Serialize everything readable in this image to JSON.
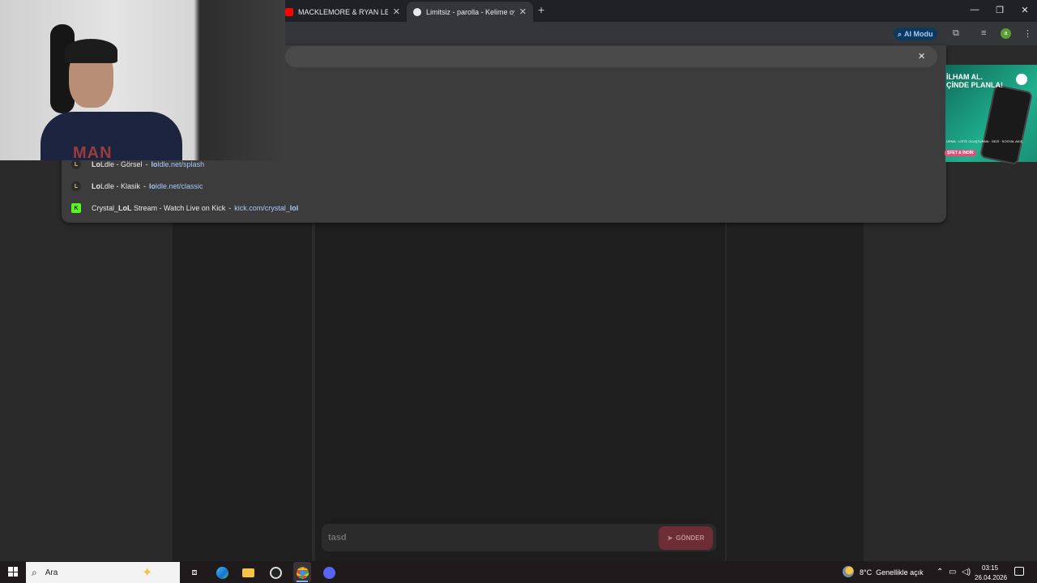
{
  "browser": {
    "tabs": [
      {
        "title": "MACKLEMORE & RYAN LEWIS",
        "favicon_color": "#ff0000",
        "active": false
      },
      {
        "title": "Limitsiz - parolla - Kelime oyunu",
        "favicon_color": "#e8eaed",
        "active": true
      }
    ],
    "new_tab_icon": "plus-icon",
    "window_controls": {
      "minimize": "—",
      "restore": "❐",
      "close": "✕"
    },
    "ai_mode_label": "AI Modu",
    "profile_initial": "a"
  },
  "omnibox": {
    "clear_icon": "✕",
    "suggestions": [
      {
        "bold": "Lo",
        "rest": "Ldle - Görsel",
        "sep": "-",
        "url_bold": "lo",
        "url_rest": "ldle.net/splash",
        "icon": "L"
      },
      {
        "bold": "Lo",
        "rest": "Ldle - Klasik",
        "sep": "-",
        "url_bold": "lo",
        "url_rest": "ldle.net/classic",
        "icon": "L"
      },
      {
        "prefix": "Crystal_",
        "bold": "LoL",
        "rest": " Stream - Watch Live on Kick",
        "sep": "-",
        "url_rest": "kick.com/crystal_",
        "url_bold": "lol",
        "icon": "K"
      }
    ]
  },
  "webcam": {
    "shirt_text": "MAN"
  },
  "ad": {
    "line1": "İLHAM AL.",
    "line2": "ÇİNDE PLANLA!",
    "small_text": "URMA · LİSTE OLUŞTURMA · GEZİ · SOSYAL AKIŞ",
    "button": "ŞFET & İNDİR"
  },
  "chat": {
    "input_value": "tasd",
    "send_label": "GÖNDER",
    "send_icon": "➤"
  },
  "taskbar": {
    "search_placeholder": "Ara",
    "weather": "8°C  Genellikle açık",
    "time": "03:15",
    "date": "26.04.2026"
  }
}
